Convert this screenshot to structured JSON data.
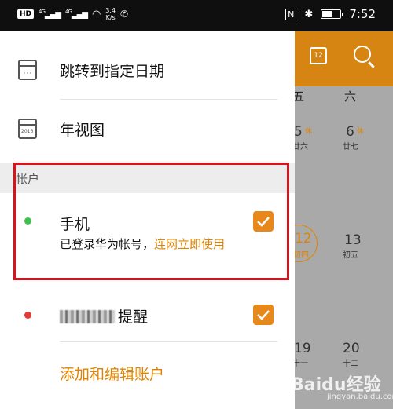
{
  "status_bar": {
    "net1": "4G",
    "net2": "4G",
    "speed_value": "3.4",
    "speed_unit": "K/s",
    "time": "7:52",
    "battery_level": 0.6
  },
  "calendar_bg": {
    "weekday_5": "五",
    "weekday_6": "六",
    "day_5": "5",
    "day_5_tag": "休",
    "day_5_lunar": "廿六",
    "day_6": "6",
    "day_6_tag": "休",
    "day_6_lunar": "廿七",
    "day_12": "12",
    "day_12_lunar": "初四",
    "day_13": "13",
    "day_13_lunar": "初五",
    "day_19": "19",
    "day_19_lunar": "十一",
    "day_20": "20",
    "day_20_lunar": "十二",
    "header_calendar_day": "12",
    "watermark": "Baidu经验",
    "watermark_sub": "jingyan.baidu.com"
  },
  "drawer": {
    "goto_date_label": "跳转到指定日期",
    "year_view_label": "年视图",
    "year_icon_text": "2016",
    "accounts_section": "帐户",
    "phone_account": {
      "name": "手机",
      "status_text": "已登录华为帐号，",
      "link_text": "连网立即使用",
      "checked": true,
      "dot_color": "#3cc24b"
    },
    "reminder_account": {
      "name": "提醒",
      "checked": true,
      "dot_color": "#e53935"
    },
    "add_edit_label": "添加和编辑账户"
  },
  "colors": {
    "accent": "#e08400",
    "highlight_box": "#d7141c"
  }
}
